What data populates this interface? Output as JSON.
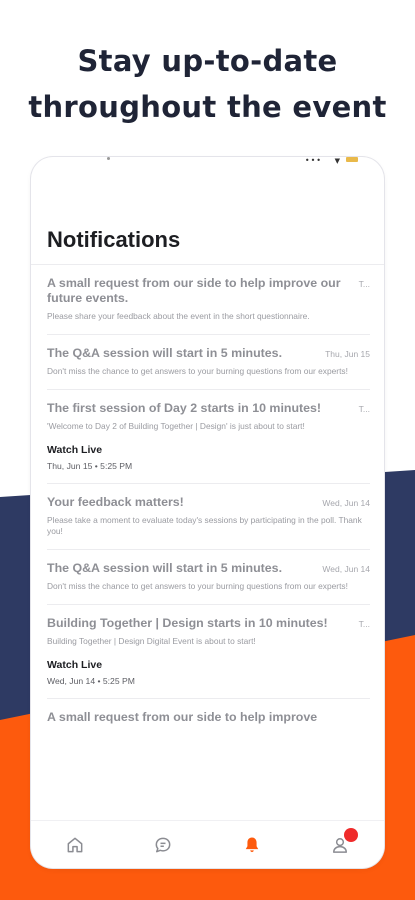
{
  "headline": {
    "line1": "Stay up-to-date",
    "line2": "throughout the event"
  },
  "colors": {
    "navy": "#2e3a63",
    "orange": "#fd5a0d",
    "active_tab": "#fd5a0d",
    "badge": "#ef2b2b"
  },
  "screen": {
    "title": "Notifications",
    "notifications": [
      {
        "title": "A small request from our side to help improve our future events.",
        "date": "T...",
        "body": "Please share your feedback about the event in the short questionnaire."
      },
      {
        "title": "The Q&A session will start in 5 minutes.",
        "date": "Thu, Jun 15",
        "body": "Don't miss the chance to get answers to your burning questions from our experts!"
      },
      {
        "title": "The first session of Day 2 starts in 10 minutes!",
        "date": "T...",
        "body": "'Welcome to Day 2 of Building Together | Design' is just about to start!",
        "watch_label": "Watch Live",
        "watch_date": "Thu, Jun 15 • 5:25 PM"
      },
      {
        "title": "Your feedback matters!",
        "date": "Wed, Jun 14",
        "body": "Please take a moment to evaluate today's sessions by participating in the poll. Thank you!"
      },
      {
        "title": "The Q&A session will start in 5 minutes.",
        "date": "Wed, Jun 14",
        "body": "Don't miss the chance to get answers to your burning questions from our experts!"
      },
      {
        "title": "Building Together | Design starts in 10 minutes!",
        "date": "T...",
        "body": "Building Together | Design Digital Event is about to start!",
        "watch_label": "Watch Live",
        "watch_date": "Wed, Jun 14 • 5:25 PM"
      },
      {
        "title": "A small request from our side to help improve",
        "date": "",
        "body": ""
      }
    ],
    "tabs": [
      {
        "icon": "home-icon",
        "active": false
      },
      {
        "icon": "chat-icon",
        "active": false
      },
      {
        "icon": "bell-icon",
        "active": true
      },
      {
        "icon": "profile-icon",
        "active": false,
        "badge": true
      }
    ]
  }
}
